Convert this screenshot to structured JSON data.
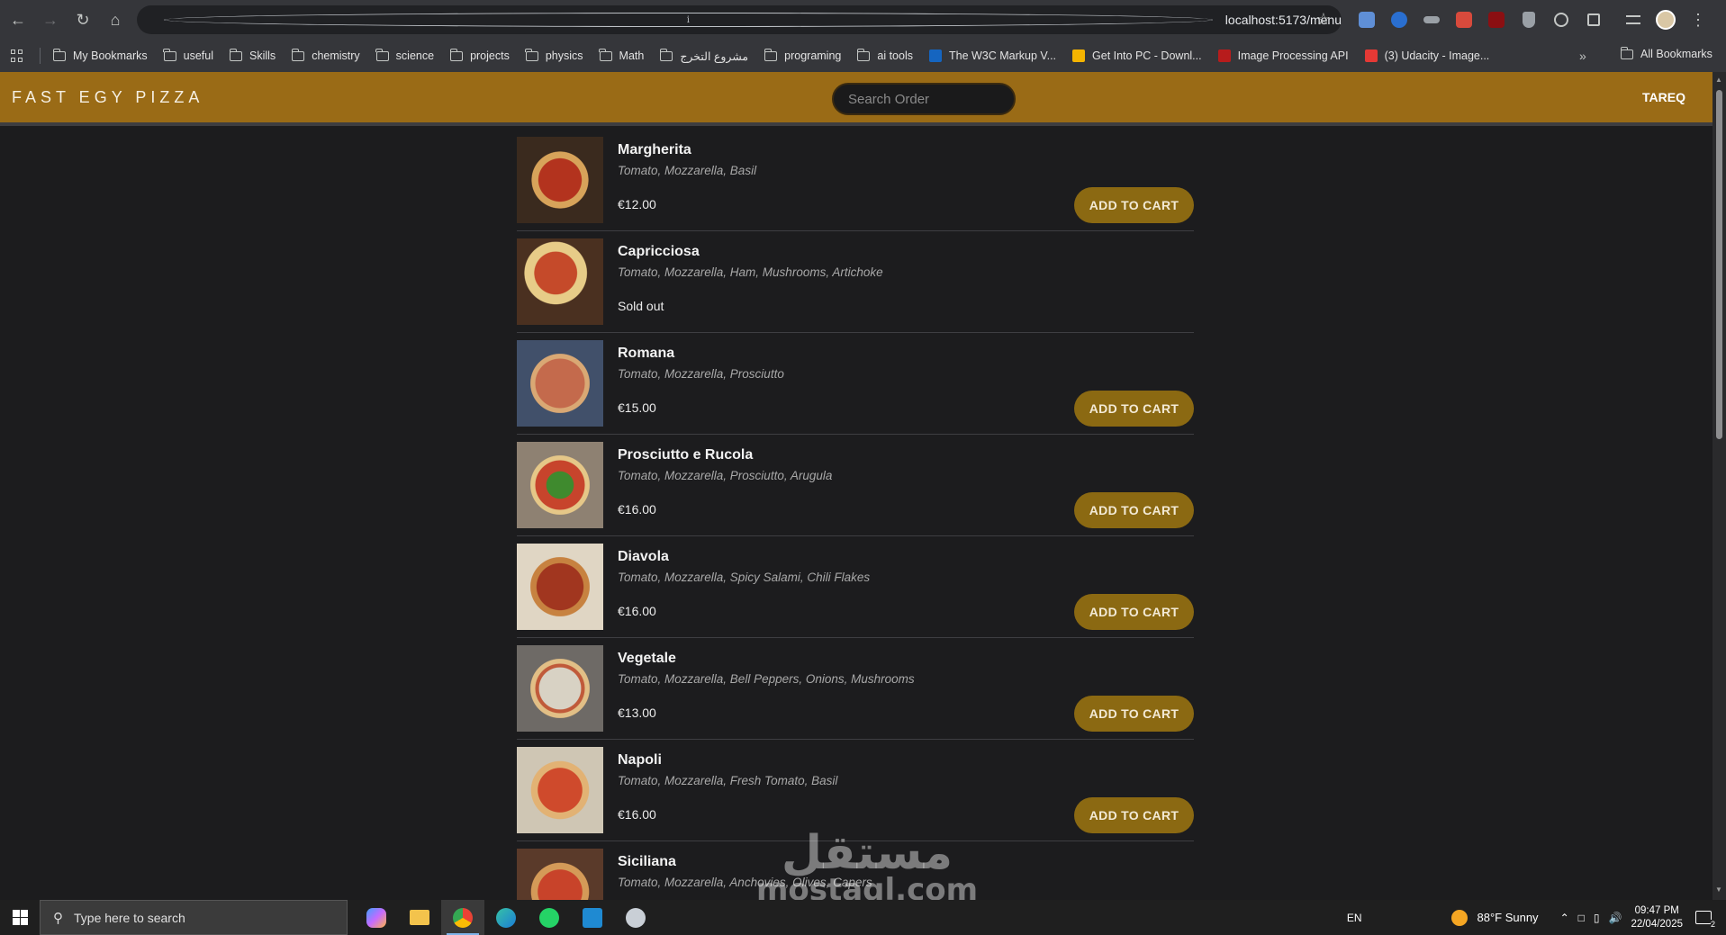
{
  "browser": {
    "url": "localhost:5173/menu",
    "bookmarks": [
      {
        "label": "My Bookmarks",
        "type": "folder"
      },
      {
        "label": "useful",
        "type": "folder"
      },
      {
        "label": "Skills",
        "type": "folder"
      },
      {
        "label": "chemistry",
        "type": "folder"
      },
      {
        "label": "science",
        "type": "folder"
      },
      {
        "label": "projects",
        "type": "folder"
      },
      {
        "label": "physics",
        "type": "folder"
      },
      {
        "label": "Math",
        "type": "folder"
      },
      {
        "label": "مشروع التخرج",
        "type": "folder"
      },
      {
        "label": "programing",
        "type": "folder"
      },
      {
        "label": "ai tools",
        "type": "folder"
      },
      {
        "label": "The W3C Markup V...",
        "type": "link"
      },
      {
        "label": "Get Into PC - Downl...",
        "type": "link"
      },
      {
        "label": "Image Processing API",
        "type": "link"
      },
      {
        "label": "(3) Udacity - Image...",
        "type": "link"
      }
    ],
    "all_bookmarks": "All Bookmarks"
  },
  "app": {
    "logo": "FAST EGY PIZZA",
    "search_placeholder": "Search Order",
    "username": "TAREQ",
    "accent": "#9a6b16",
    "button_color": "#8b6912"
  },
  "menu": [
    {
      "name": "Margherita",
      "ingredients": "Tomato, Mozzarella, Basil",
      "price": "€12.00",
      "button": "ADD TO CART"
    },
    {
      "name": "Capricciosa",
      "ingredients": "Tomato, Mozzarella, Ham, Mushrooms, Artichoke",
      "status": "Sold out"
    },
    {
      "name": "Romana",
      "ingredients": "Tomato, Mozzarella, Prosciutto",
      "price": "€15.00",
      "button": "ADD TO CART"
    },
    {
      "name": "Prosciutto e Rucola",
      "ingredients": "Tomato, Mozzarella, Prosciutto, Arugula",
      "price": "€16.00",
      "button": "ADD TO CART"
    },
    {
      "name": "Diavola",
      "ingredients": "Tomato, Mozzarella, Spicy Salami, Chili Flakes",
      "price": "€16.00",
      "button": "ADD TO CART"
    },
    {
      "name": "Vegetale",
      "ingredients": "Tomato, Mozzarella, Bell Peppers, Onions, Mushrooms",
      "price": "€13.00",
      "button": "ADD TO CART"
    },
    {
      "name": "Napoli",
      "ingredients": "Tomato, Mozzarella, Fresh Tomato, Basil",
      "price": "€16.00",
      "button": "ADD TO CART"
    },
    {
      "name": "Siciliana",
      "ingredients": "Tomato, Mozzarella, Anchovies, Olives, Capers"
    }
  ],
  "watermark": {
    "arabic": "مستقل",
    "latin": "mostaql.com"
  },
  "taskbar": {
    "search_placeholder": "Type here to search",
    "language": "EN",
    "weather": "88°F  Sunny",
    "time": "09:47 PM",
    "date": "22/04/2025",
    "notifications": "2"
  }
}
